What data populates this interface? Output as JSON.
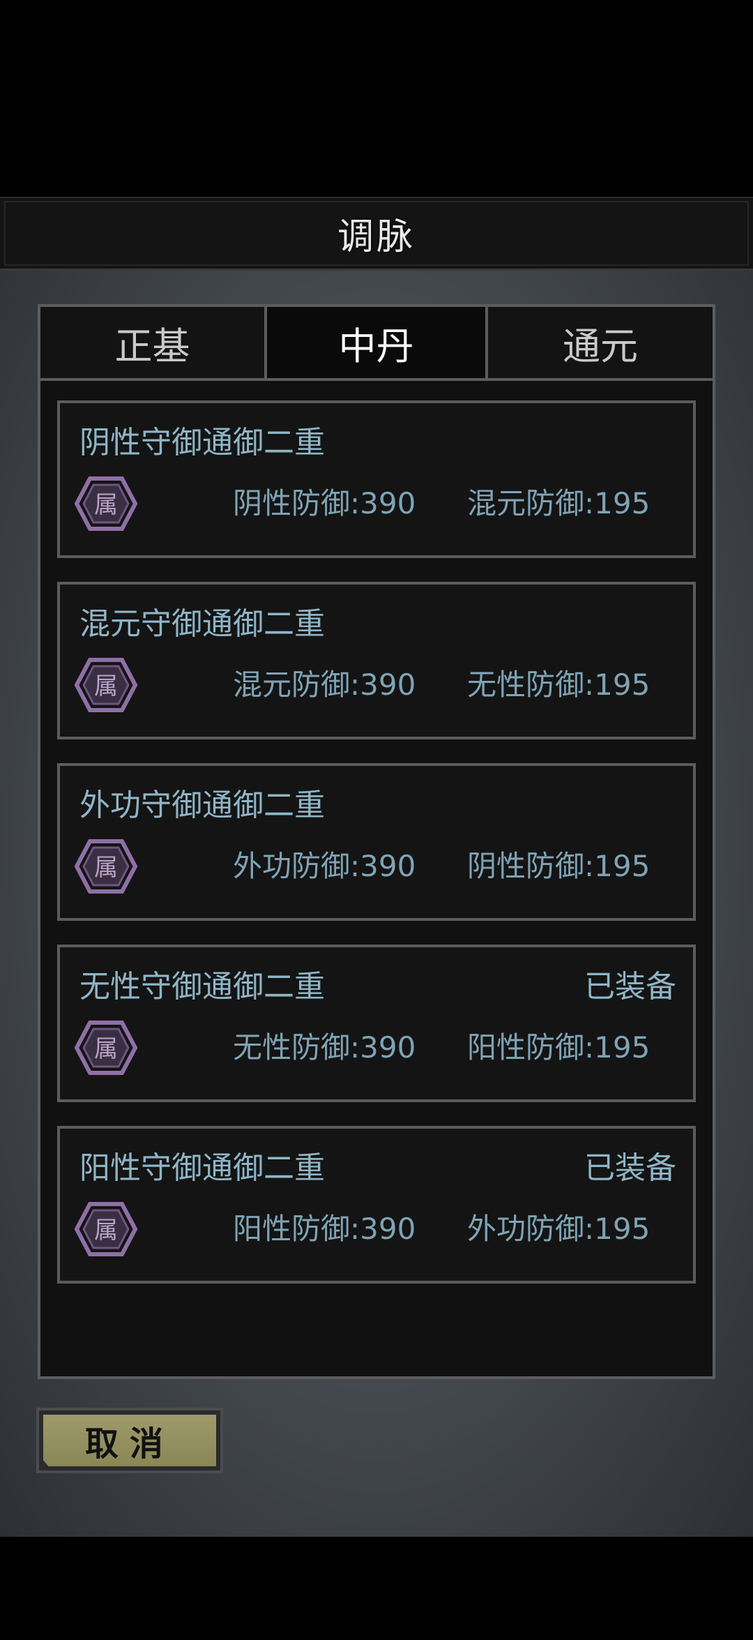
{
  "title": "调脉",
  "tabs": [
    {
      "label": "正基",
      "active": false
    },
    {
      "label": "中丹",
      "active": true
    },
    {
      "label": "通元",
      "active": false
    }
  ],
  "icon_label": "属",
  "cards": [
    {
      "name": "阴性守御通御二重",
      "stat1": "阴性防御:390",
      "stat2": "混元防御:195",
      "equipped": ""
    },
    {
      "name": "混元守御通御二重",
      "stat1": "混元防御:390",
      "stat2": "无性防御:195",
      "equipped": ""
    },
    {
      "name": "外功守御通御二重",
      "stat1": "外功防御:390",
      "stat2": "阴性防御:195",
      "equipped": ""
    },
    {
      "name": "无性守御通御二重",
      "stat1": "无性防御:390",
      "stat2": "阳性防御:195",
      "equipped": "已装备"
    },
    {
      "name": "阳性守御通御二重",
      "stat1": "阳性防御:390",
      "stat2": "外功防御:195",
      "equipped": "已装备"
    }
  ],
  "cancel_label": "取消",
  "colors": {
    "accent_text": "#8fb5c7",
    "icon_purple": "#8f6fa6",
    "button": "#9e9a6a"
  }
}
